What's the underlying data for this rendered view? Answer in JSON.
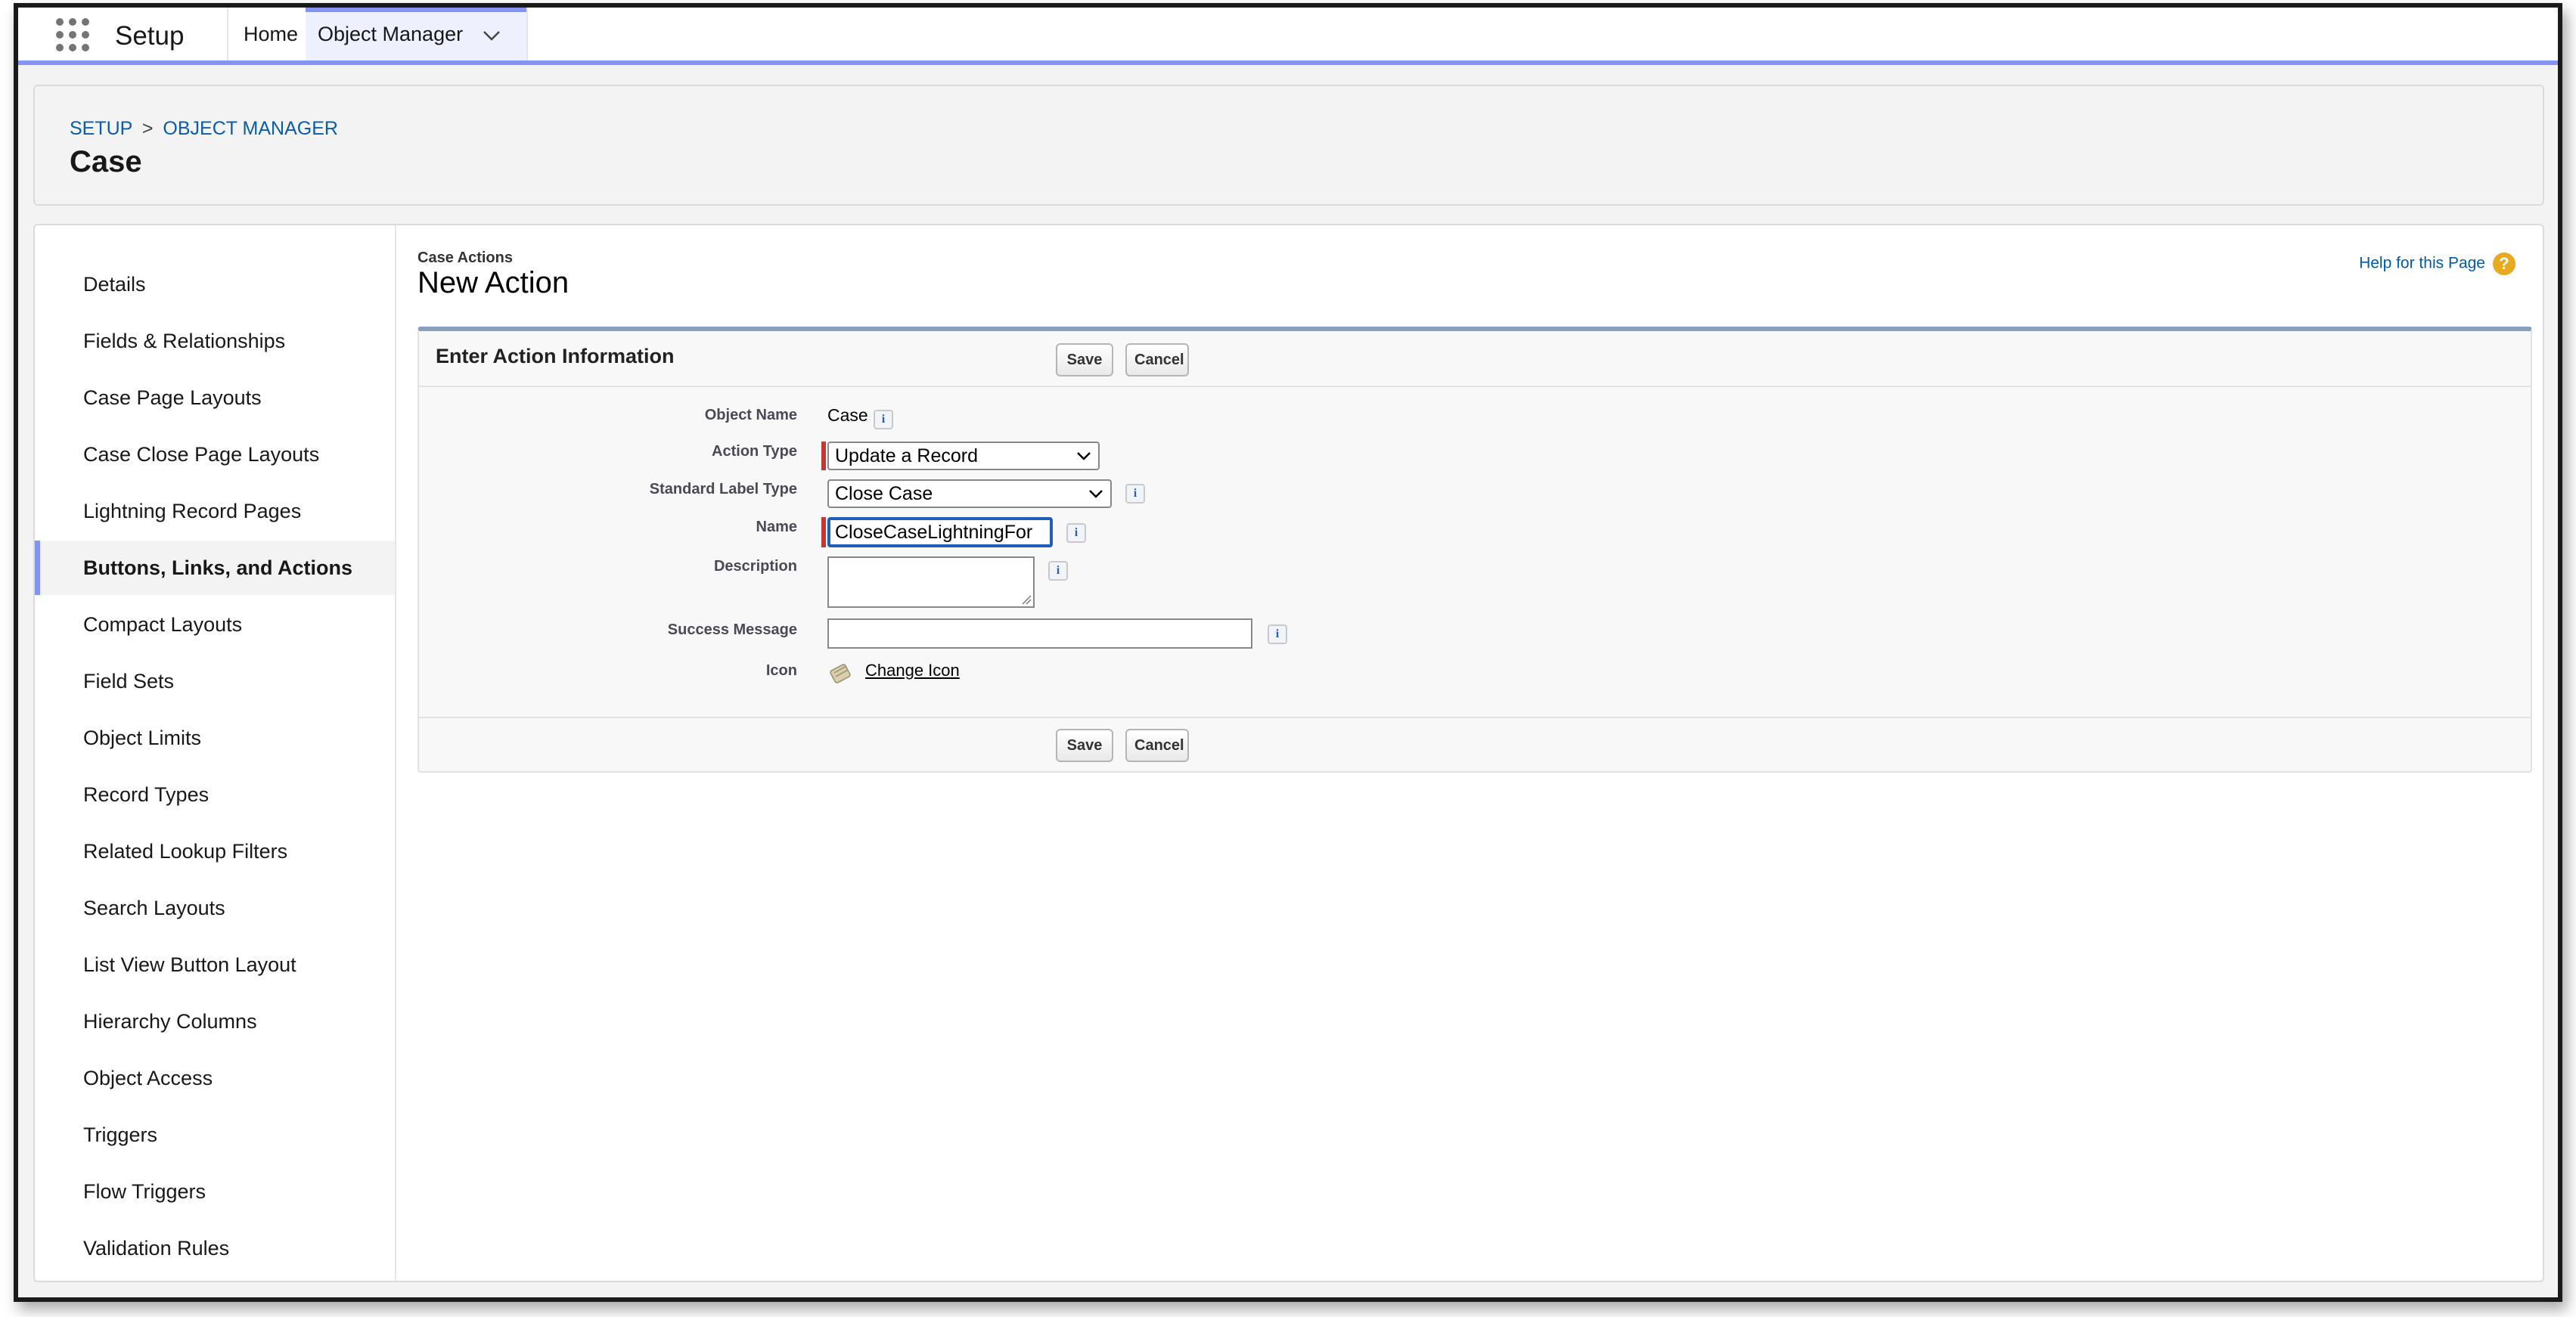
{
  "nav": {
    "app_title": "Setup",
    "home_tab": "Home",
    "object_manager_tab": "Object Manager"
  },
  "header": {
    "breadcrumb_setup": "SETUP",
    "breadcrumb_sep": ">",
    "breadcrumb_object_manager": "OBJECT MANAGER",
    "title": "Case"
  },
  "sidebar": {
    "items": [
      {
        "label": "Details"
      },
      {
        "label": "Fields & Relationships"
      },
      {
        "label": "Case Page Layouts"
      },
      {
        "label": "Case Close Page Layouts"
      },
      {
        "label": "Lightning Record Pages"
      },
      {
        "label": "Buttons, Links, and Actions"
      },
      {
        "label": "Compact Layouts"
      },
      {
        "label": "Field Sets"
      },
      {
        "label": "Object Limits"
      },
      {
        "label": "Record Types"
      },
      {
        "label": "Related Lookup Filters"
      },
      {
        "label": "Search Layouts"
      },
      {
        "label": "List View Button Layout"
      },
      {
        "label": "Hierarchy Columns"
      },
      {
        "label": "Object Access"
      },
      {
        "label": "Triggers"
      },
      {
        "label": "Flow Triggers"
      },
      {
        "label": "Validation Rules"
      }
    ],
    "active_index": 5
  },
  "content": {
    "subtitle": "Case Actions",
    "title": "New Action",
    "help_link": "Help for this Page",
    "help_icon_glyph": "?"
  },
  "form": {
    "header_title": "Enter Action Information",
    "save_label": "Save",
    "cancel_label": "Cancel",
    "info_glyph": "i",
    "fields": {
      "object_name_label": "Object Name",
      "object_name_value": "Case",
      "action_type_label": "Action Type",
      "action_type_value": "Update a Record",
      "standard_label_type_label": "Standard Label Type",
      "standard_label_type_value": "Close Case",
      "name_label": "Name",
      "name_value": "CloseCaseLightningFor",
      "description_label": "Description",
      "description_value": "",
      "success_message_label": "Success Message",
      "success_message_value": "",
      "icon_label": "Icon",
      "change_icon_label": "Change Icon"
    }
  },
  "colors": {
    "accent": "#8394f3",
    "link": "#0b5cab",
    "required": "#c23934",
    "help": "#e8a923"
  }
}
